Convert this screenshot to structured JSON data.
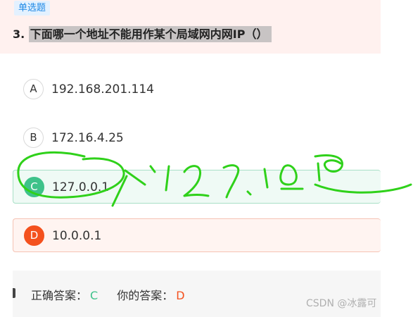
{
  "question": {
    "type_label": "单选题",
    "number": "3.",
    "text": "下面哪一个地址不能用作某个局域网内网IP（）"
  },
  "options": [
    {
      "letter": "A",
      "text": "192.168.201.114",
      "state": "normal"
    },
    {
      "letter": "B",
      "text": "172.16.4.25",
      "state": "normal"
    },
    {
      "letter": "C",
      "text": "127.0.0.1",
      "state": "correct"
    },
    {
      "letter": "D",
      "text": "10.0.0.1",
      "state": "wrong"
    }
  ],
  "answer": {
    "correct_label": "正确答案：",
    "correct_value": "C",
    "yours_label": "你的答案：",
    "yours_value": "D"
  },
  "watermark": "CSDN @冰露可",
  "colors": {
    "header_bg": "#fff1ef",
    "correct": "#3ec28a",
    "wrong": "#f4511e",
    "tag_blue": "#1e88e5",
    "annotation_ink": "#2fd11a"
  }
}
